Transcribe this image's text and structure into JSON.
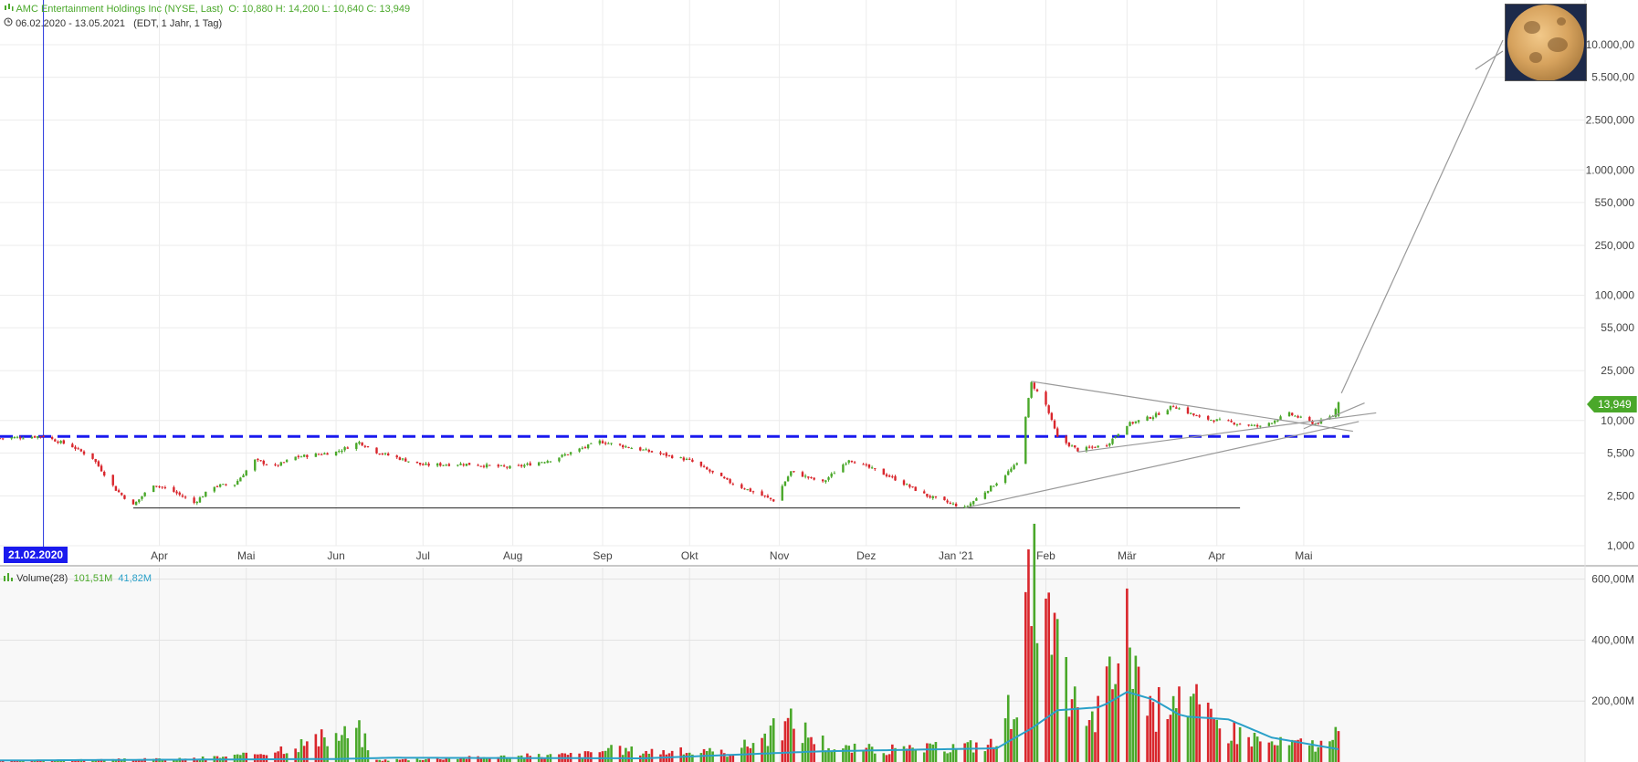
{
  "header": {
    "title": "AMC Entertainment Holdings Inc (NYSE, Last)",
    "ohlc": "O: 10,880   H: 14,200   L: 10,640   C: 13,949",
    "range": "06.02.2020 - 13.05.2021",
    "meta": "(EDT, 1 Jahr, 1 Tag)"
  },
  "crosshair_date": "21.02.2020",
  "last_price_label": "13,949",
  "volume_header": {
    "label": "Volume(28)",
    "value": "101,51M",
    "avg": "41,82M"
  },
  "colors": {
    "up": "#4aa82a",
    "down": "#d9262c",
    "volume_avg": "#2aa0c8",
    "resistance": "#1a1aee",
    "crosshair": "#2233dd"
  },
  "icons": [
    "candlestick-icon",
    "clock-icon",
    "volume-bars-icon",
    "moon-image"
  ],
  "chart_data": [
    {
      "type": "candlestick",
      "scale": "log",
      "x_tick_labels": [
        "Apr",
        "Mai",
        "Jun",
        "Jul",
        "Aug",
        "Sep",
        "Okt",
        "Nov",
        "Dez",
        "Jan '21",
        "Feb",
        "Mär",
        "Apr",
        "Mai"
      ],
      "y_tick_labels": [
        "10.000,00",
        "5.500,00",
        "2.500,000",
        "1.000,000",
        "550,000",
        "250,000",
        "100,000",
        "55,000",
        "25,000",
        "10,000",
        "5,500",
        "2,500",
        "1,000"
      ],
      "y_tick_values": [
        10000,
        5500,
        2500,
        1000,
        550,
        250,
        100,
        55,
        25,
        10,
        5.5,
        2.5,
        1
      ],
      "ylim": [
        0.8,
        15000
      ],
      "price_path": [
        {
          "date": "2020-02-06",
          "close": 7.2
        },
        {
          "date": "2020-02-21",
          "close": 7.5
        },
        {
          "date": "2020-03-02",
          "close": 6.2
        },
        {
          "date": "2020-03-09",
          "close": 5.0
        },
        {
          "date": "2020-03-17",
          "close": 2.8
        },
        {
          "date": "2020-03-23",
          "close": 2.1
        },
        {
          "date": "2020-03-30",
          "close": 3.1
        },
        {
          "date": "2020-04-06",
          "close": 2.7
        },
        {
          "date": "2020-04-13",
          "close": 2.2
        },
        {
          "date": "2020-04-20",
          "close": 3.0
        },
        {
          "date": "2020-04-27",
          "close": 3.1
        },
        {
          "date": "2020-05-04",
          "close": 4.8
        },
        {
          "date": "2020-05-11",
          "close": 4.3
        },
        {
          "date": "2020-05-18",
          "close": 5.1
        },
        {
          "date": "2020-06-01",
          "close": 5.6
        },
        {
          "date": "2020-06-09",
          "close": 6.7
        },
        {
          "date": "2020-06-15",
          "close": 5.6
        },
        {
          "date": "2020-07-01",
          "close": 4.4
        },
        {
          "date": "2020-07-15",
          "close": 4.5
        },
        {
          "date": "2020-08-01",
          "close": 4.2
        },
        {
          "date": "2020-08-15",
          "close": 4.9
        },
        {
          "date": "2020-08-31",
          "close": 6.8
        },
        {
          "date": "2020-09-15",
          "close": 5.8
        },
        {
          "date": "2020-10-01",
          "close": 4.8
        },
        {
          "date": "2020-10-15",
          "close": 3.2
        },
        {
          "date": "2020-10-30",
          "close": 2.3
        },
        {
          "date": "2020-11-05",
          "close": 3.9
        },
        {
          "date": "2020-11-16",
          "close": 3.2
        },
        {
          "date": "2020-11-25",
          "close": 4.9
        },
        {
          "date": "2020-12-10",
          "close": 3.5
        },
        {
          "date": "2020-12-22",
          "close": 2.5
        },
        {
          "date": "2021-01-04",
          "close": 2.0
        },
        {
          "date": "2021-01-15",
          "close": 3.2
        },
        {
          "date": "2021-01-22",
          "close": 4.5
        },
        {
          "date": "2021-01-27",
          "close": 19.9
        },
        {
          "date": "2021-02-01",
          "close": 13.3
        },
        {
          "date": "2021-02-05",
          "close": 7.3
        },
        {
          "date": "2021-02-12",
          "close": 5.8
        },
        {
          "date": "2021-02-22",
          "close": 6.4
        },
        {
          "date": "2021-03-01",
          "close": 9.3
        },
        {
          "date": "2021-03-10",
          "close": 10.8
        },
        {
          "date": "2021-03-17",
          "close": 13.1
        },
        {
          "date": "2021-03-26",
          "close": 10.5
        },
        {
          "date": "2021-04-09",
          "close": 9.4
        },
        {
          "date": "2021-04-16",
          "close": 8.9
        },
        {
          "date": "2021-04-26",
          "close": 11.3
        },
        {
          "date": "2021-05-05",
          "close": 9.4
        },
        {
          "date": "2021-05-11",
          "close": 10.9
        },
        {
          "date": "2021-05-13",
          "close": 13.949
        }
      ],
      "resistance_level": 7.45,
      "support_level": 2.0
    },
    {
      "type": "bar",
      "title": "Volume(28)",
      "y_tick_labels": [
        "600,00M",
        "400,00M",
        "200,00M"
      ],
      "y_tick_values": [
        600,
        400,
        200
      ],
      "ylim": [
        0,
        620
      ],
      "volume_profile": [
        {
          "date": "2020-02-06",
          "vol": 3
        },
        {
          "date": "2020-03-15",
          "vol": 8
        },
        {
          "date": "2020-04-10",
          "vol": 10
        },
        {
          "date": "2020-05-01",
          "vol": 22
        },
        {
          "date": "2020-06-09",
          "vol": 100
        },
        {
          "date": "2020-06-15",
          "vol": 6
        },
        {
          "date": "2020-08-25",
          "vol": 25
        },
        {
          "date": "2020-09-02",
          "vol": 40
        },
        {
          "date": "2020-10-15",
          "vol": 30
        },
        {
          "date": "2020-11-05",
          "vol": 130
        },
        {
          "date": "2020-11-20",
          "vol": 45
        },
        {
          "date": "2020-12-15",
          "vol": 40
        },
        {
          "date": "2021-01-15",
          "vol": 60
        },
        {
          "date": "2021-01-22",
          "vol": 250
        },
        {
          "date": "2021-01-27",
          "vol": 590
        },
        {
          "date": "2021-02-03",
          "vol": 380
        },
        {
          "date": "2021-02-15",
          "vol": 100
        },
        {
          "date": "2021-02-24",
          "vol": 280
        },
        {
          "date": "2021-03-01",
          "vol": 440
        },
        {
          "date": "2021-03-10",
          "vol": 140
        },
        {
          "date": "2021-03-17",
          "vol": 280
        },
        {
          "date": "2021-03-30",
          "vol": 130
        },
        {
          "date": "2021-04-20",
          "vol": 60
        },
        {
          "date": "2021-05-11",
          "vol": 60
        },
        {
          "date": "2021-05-13",
          "vol": 101.51
        }
      ],
      "avg_profile": [
        {
          "date": "2020-02-06",
          "vol": 5
        },
        {
          "date": "2020-06-01",
          "vol": 10
        },
        {
          "date": "2020-06-20",
          "vol": 14
        },
        {
          "date": "2020-09-15",
          "vol": 12
        },
        {
          "date": "2020-11-15",
          "vol": 35
        },
        {
          "date": "2021-01-15",
          "vol": 45
        },
        {
          "date": "2021-01-27",
          "vol": 110
        },
        {
          "date": "2021-02-05",
          "vol": 170
        },
        {
          "date": "2021-02-20",
          "vol": 180
        },
        {
          "date": "2021-03-01",
          "vol": 230
        },
        {
          "date": "2021-03-10",
          "vol": 205
        },
        {
          "date": "2021-03-20",
          "vol": 150
        },
        {
          "date": "2021-04-05",
          "vol": 140
        },
        {
          "date": "2021-04-20",
          "vol": 80
        },
        {
          "date": "2021-05-13",
          "vol": 41.82
        }
      ]
    }
  ]
}
